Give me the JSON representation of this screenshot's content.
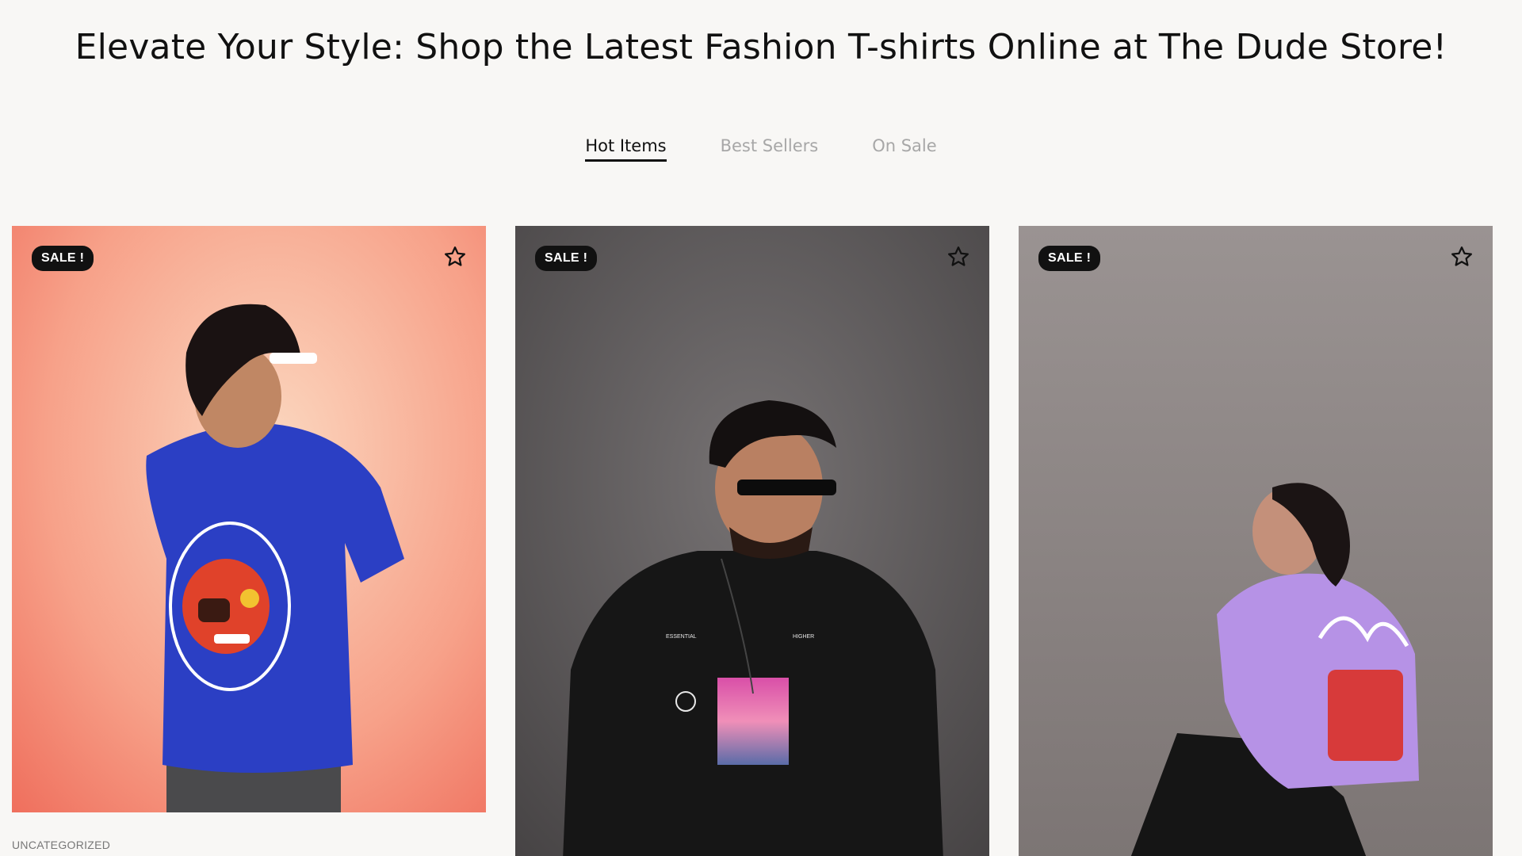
{
  "headline": "Elevate Your Style: Shop the Latest Fashion T-shirts Online at The Dude Store!",
  "tabs": [
    {
      "label": "Hot Items",
      "active": true
    },
    {
      "label": "Best Sellers",
      "active": false
    },
    {
      "label": "On Sale",
      "active": false
    }
  ],
  "products": [
    {
      "badge": "SALE !",
      "wishlist_icon": "star-outline-icon",
      "category": "UNCATEGORIZED",
      "background": "#f59a86",
      "shirt_color": "#2b3fc4"
    },
    {
      "badge": "SALE !",
      "wishlist_icon": "star-outline-icon",
      "category": "",
      "background": "#5a5758",
      "shirt_color": "#161616"
    },
    {
      "badge": "SALE !",
      "wishlist_icon": "star-outline-icon",
      "category": "",
      "background": "#8c8584",
      "shirt_color": "#b692e6"
    }
  ]
}
